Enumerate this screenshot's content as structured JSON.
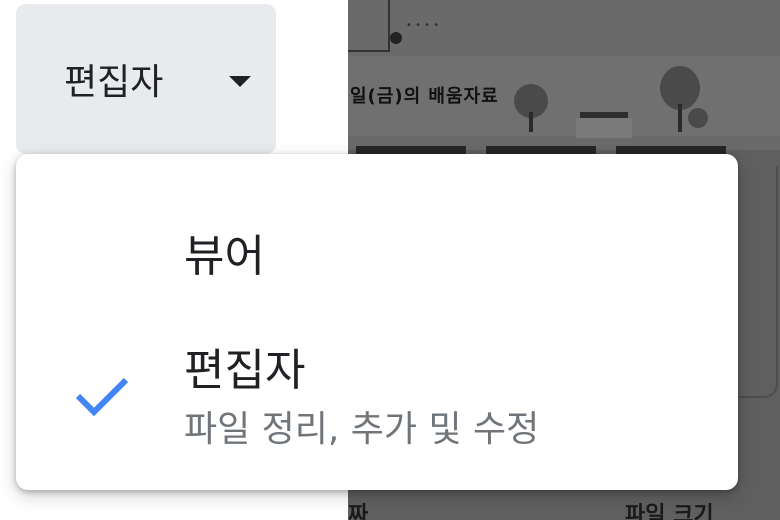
{
  "role_button": {
    "label": "편집자",
    "icon": "caret-down-icon"
  },
  "menu": {
    "items": [
      {
        "label": "뷰어",
        "description": "",
        "selected": false
      },
      {
        "label": "편집자",
        "description": "파일 정리, 추가 및 수정",
        "selected": true,
        "icon": "checkmark-icon"
      }
    ],
    "check_color": "#4285f4"
  },
  "background": {
    "banner_caption": "일(금)의 배움자료",
    "bottom_left_text": "짜",
    "bottom_right_text": "파일 크기"
  }
}
